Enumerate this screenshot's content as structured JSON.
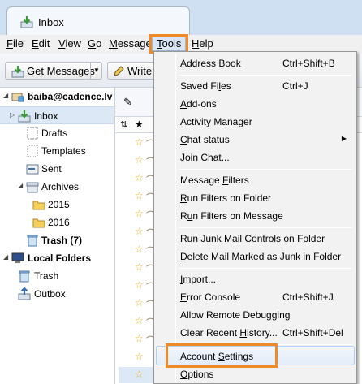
{
  "window": {
    "tab_title": "Inbox"
  },
  "menubar": {
    "items": [
      {
        "label": "File",
        "mnemonic": "F",
        "rest": "ile"
      },
      {
        "label": "Edit",
        "mnemonic": "E",
        "rest": "dit"
      },
      {
        "label": "View",
        "mnemonic": "V",
        "rest": "iew"
      },
      {
        "label": "Go",
        "mnemonic": "G",
        "rest": "o"
      },
      {
        "label": "Message",
        "mnemonic": "M",
        "rest": "essage"
      },
      {
        "label": "Tools",
        "mnemonic": "T",
        "rest": "ools"
      },
      {
        "label": "Help",
        "mnemonic": "H",
        "rest": "elp"
      }
    ]
  },
  "toolbar": {
    "get_messages": "Get Messages",
    "write": "Write"
  },
  "folders": {
    "account": "baiba@cadence.lv",
    "inbox": "Inbox",
    "drafts": "Drafts",
    "templates": "Templates",
    "sent": "Sent",
    "archives": "Archives",
    "y2015": "2015",
    "y2016": "2016",
    "trash": "Trash (7)",
    "local_folders": "Local Folders",
    "local_trash": "Trash",
    "outbox": "Outbox"
  },
  "tools_menu": {
    "address_book": {
      "label": "Address Book",
      "mn": "",
      "shortcut": "Ctrl+Shift+B"
    },
    "saved_files": {
      "pre": "Saved Fi",
      "mn": "l",
      "post": "es",
      "shortcut": "Ctrl+J"
    },
    "addons": {
      "pre": "",
      "mn": "A",
      "post": "dd-ons"
    },
    "activity_manager": {
      "label": "Activity Manager"
    },
    "chat_status": {
      "pre": "",
      "mn": "C",
      "post": "hat status"
    },
    "join_chat": {
      "pre": "Join Chat",
      "mn": "",
      "post": "..."
    },
    "message_filters": {
      "pre": "Message ",
      "mn": "F",
      "post": "ilters"
    },
    "run_filters_folder": {
      "pre": "",
      "mn": "R",
      "post": "un Filters on Folder"
    },
    "run_filters_message": {
      "pre": "R",
      "mn": "u",
      "post": "n Filters on Message"
    },
    "run_junk": {
      "label": "Run Junk Mail Controls on Folder"
    },
    "delete_junk": {
      "pre": "",
      "mn": "D",
      "post": "elete Mail Marked as Junk in Folder"
    },
    "import": {
      "pre": "",
      "mn": "I",
      "post": "mport..."
    },
    "error_console": {
      "pre": "",
      "mn": "E",
      "post": "rror Console",
      "shortcut": "Ctrl+Shift+J"
    },
    "remote_debugging": {
      "label": "Allow Remote Debugging"
    },
    "clear_history": {
      "pre": "Clear Recent ",
      "mn": "H",
      "post": "istory...",
      "shortcut": "Ctrl+Shift+Del"
    },
    "account_settings": {
      "pre": "Account ",
      "mn": "S",
      "post": "ettings"
    },
    "options": {
      "pre": "",
      "mn": "O",
      "post": "ptions"
    }
  },
  "colors": {
    "highlight": "#f08a24",
    "selection": "#dde8f6"
  }
}
